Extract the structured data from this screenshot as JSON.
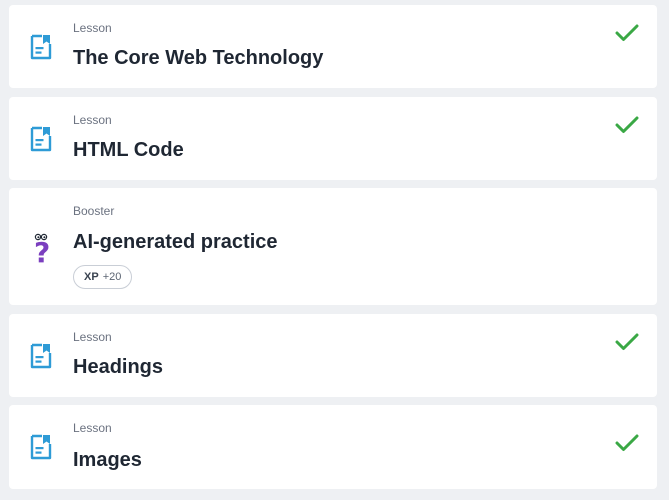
{
  "items": [
    {
      "kicker": "Lesson",
      "title": "The Core Web Technology",
      "completed": true,
      "icon": "lesson-doc-icon"
    },
    {
      "kicker": "Lesson",
      "title": "HTML Code",
      "completed": true,
      "icon": "lesson-doc-icon"
    },
    {
      "kicker": "Booster",
      "title": "AI-generated practice",
      "completed": false,
      "icon": "question-mark-icon",
      "xp_label": "XP",
      "xp_value": "+20"
    },
    {
      "kicker": "Lesson",
      "title": "Headings",
      "completed": true,
      "icon": "lesson-doc-icon"
    },
    {
      "kicker": "Lesson",
      "title": "Images",
      "completed": true,
      "icon": "lesson-doc-icon"
    }
  ],
  "colors": {
    "lesson_icon": "#2e9bd6",
    "check": "#3aa845",
    "booster_icon": "#7b3fbf"
  }
}
